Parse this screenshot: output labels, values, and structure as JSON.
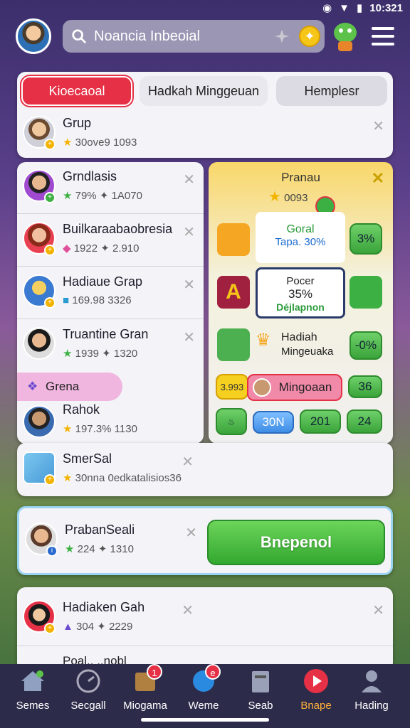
{
  "status": {
    "time": "10:321"
  },
  "search": {
    "text": "Noancia Inbeoial"
  },
  "tabs": [
    {
      "label": "Kioecaoal"
    },
    {
      "label": "Hadkah Minggeuan"
    },
    {
      "label": "Hemplesr"
    }
  ],
  "grup_row": {
    "name": "Grup",
    "meta": "30ove9 1093"
  },
  "left_list": [
    {
      "name": "Grndlasis",
      "meta": "79% ✦ 1A070"
    },
    {
      "name": "Builkaraabaobresia",
      "meta": "1922 ✦ 2.910"
    },
    {
      "name": "Hadiaue Grap",
      "meta": "169.98 3326"
    },
    {
      "name": "Truantine Gran",
      "meta": "1939 ✦ 1320"
    },
    {
      "name": "Rahok",
      "meta": "197.3% 1130"
    }
  ],
  "grena": {
    "label": "Grena"
  },
  "panel": {
    "title": "Pranau",
    "count": "0093",
    "goral_title": "Goral",
    "goral_sub": "Tapa. 30%",
    "pct1": "3%",
    "pocr_title": "Pocer",
    "pocr_value": "35%",
    "pocr_sub": "Déjlapnon",
    "hadiah_title": "Hadiah",
    "hadiah_sub": "Mingeuaka",
    "pct2": "-0%",
    "score_left": "3.993",
    "mingoaan": "Mingoaan",
    "val_36": "36",
    "btn_30n": "30N",
    "btn_201": "201",
    "btn_24": "24"
  },
  "smersal": {
    "name": "SmerSal",
    "meta": "30nna 0edkatalisios36"
  },
  "prabsali": {
    "name": "PrabanSeali",
    "meta": "224 ✦ 1310",
    "button": "Bnepenol"
  },
  "hadiaken": {
    "name": "Hadiaken Gah",
    "meta": "304 ✦ 2229",
    "next": "Poal.. ..nobl"
  },
  "nav": [
    {
      "label": "Semes"
    },
    {
      "label": "Secgall"
    },
    {
      "label": "Miogama",
      "badge": "1"
    },
    {
      "label": "Weme",
      "badge": "e"
    },
    {
      "label": "Seab"
    },
    {
      "label": "Bnape"
    },
    {
      "label": "Hading"
    }
  ],
  "colors": {
    "accent_red": "#e63046",
    "accent_green": "#3aa43a",
    "nav_bg": "#2d2b4a"
  }
}
